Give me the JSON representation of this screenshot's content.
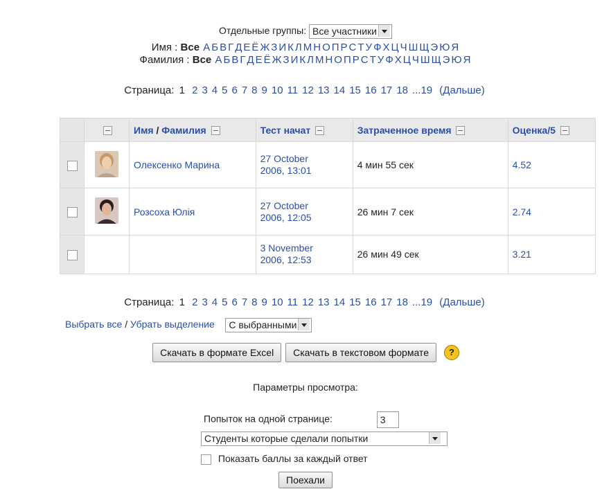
{
  "groups": {
    "label": "Отдельные группы:",
    "selected": "Все участники"
  },
  "letters": [
    "А",
    "Б",
    "В",
    "Г",
    "Д",
    "Е",
    "Ё",
    "Ж",
    "З",
    "И",
    "К",
    "Л",
    "М",
    "Н",
    "О",
    "П",
    "Р",
    "С",
    "Т",
    "У",
    "Ф",
    "Х",
    "Ц",
    "Ч",
    "Ш",
    "Щ",
    "Э",
    "Ю",
    "Я"
  ],
  "name_filter": {
    "label": "Имя :",
    "all": "Все"
  },
  "surname_filter": {
    "label": "Фамилия :",
    "all": "Все"
  },
  "pager": {
    "label": "Страница:",
    "current": "1",
    "pages": [
      "2",
      "3",
      "4",
      "5",
      "6",
      "7",
      "8",
      "9",
      "10",
      "11",
      "12",
      "13",
      "14",
      "15",
      "16",
      "17",
      "18",
      "...19"
    ],
    "next": "(Дальше)"
  },
  "table": {
    "headers": {
      "name": "Имя",
      "sep": "/",
      "surname": "Фамилия",
      "started": "Тест начат",
      "time": "Затраченное время",
      "grade": "Оценка/5"
    },
    "rows": [
      {
        "name": "Олексенко Марина",
        "date_l1": "27 October",
        "date_l2": "2006, 13:01",
        "time": "4 мин 55 сек",
        "grade": "4.52"
      },
      {
        "name": "Розсоха Юлія",
        "date_l1": "27 October",
        "date_l2": "2006, 12:05",
        "time": "26 мин 7 сек",
        "grade": "2.74"
      },
      {
        "name": "",
        "date_l1": "3 November",
        "date_l2": "2006, 12:53",
        "time": "26 мин 49 сек",
        "grade": "3.21"
      }
    ]
  },
  "selection": {
    "select_all": "Выбрать все",
    "sep": "/",
    "deselect": "Убрать выделение",
    "with_selected": "С выбранными"
  },
  "buttons": {
    "excel": "Скачать в формате Excel",
    "text": "Скачать в текстовом формате",
    "help": "?"
  },
  "view_options": {
    "title": "Параметры просмотра:",
    "attempts_label": "Попыток на одной странице:",
    "attempts_value": "3",
    "filter_selected": "Студенты которые сделали попытки",
    "show_marks_label": "Показать баллы за каждый ответ",
    "go": "Поехали"
  },
  "colors": {
    "link": "#2a4ea8",
    "header_bg": "#e9e9e9",
    "help_icon": "#f3c322"
  }
}
